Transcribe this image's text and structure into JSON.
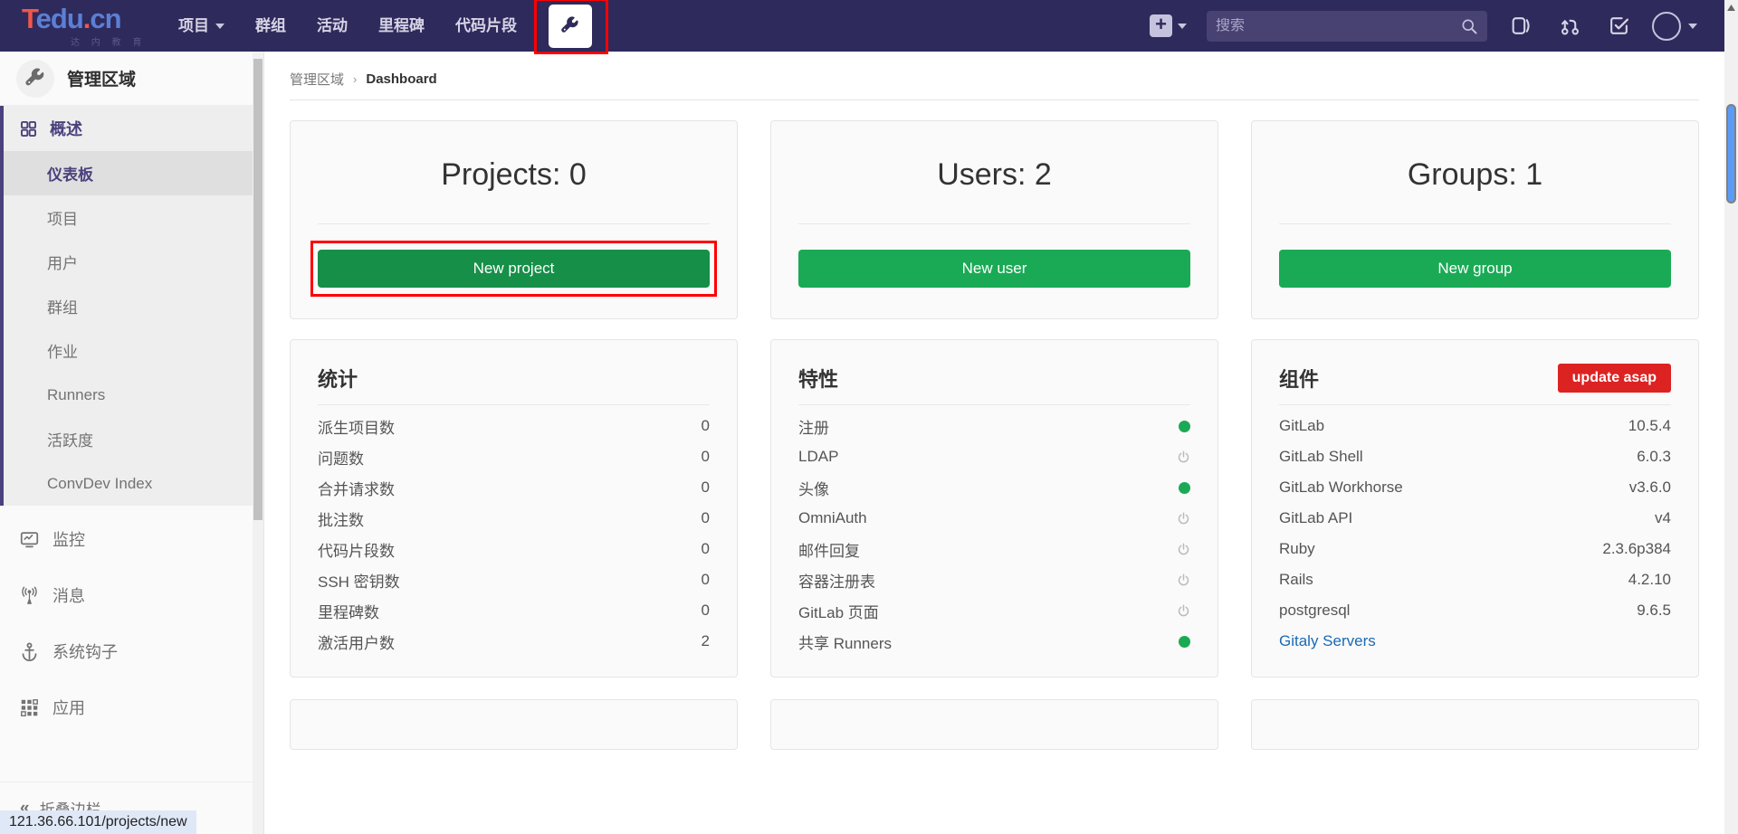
{
  "navbar": {
    "brand": {
      "t": "T",
      "edu": "edu",
      "dot": ".",
      "cn": "cn",
      "sub": "达 内 教 育"
    },
    "items": [
      {
        "label": "项目",
        "has_caret": true
      },
      {
        "label": "群组",
        "has_caret": false
      },
      {
        "label": "活动",
        "has_caret": false
      },
      {
        "label": "里程碑",
        "has_caret": false
      },
      {
        "label": "代码片段",
        "has_caret": false
      }
    ],
    "admin_icon": "wrench-icon",
    "plus_label": "+",
    "search": {
      "placeholder": "搜索",
      "value": ""
    },
    "right_icons": [
      "issues-icon",
      "merge-requests-icon",
      "todos-icon"
    ],
    "avatar": "user-avatar"
  },
  "sidebar": {
    "header": {
      "title": "管理区域",
      "icon": "wrench-icon"
    },
    "overview": {
      "label": "概述",
      "icon": "grid-icon"
    },
    "sub_items": [
      {
        "label": "仪表板",
        "active": true
      },
      {
        "label": "项目",
        "active": false
      },
      {
        "label": "用户",
        "active": false
      },
      {
        "label": "群组",
        "active": false
      },
      {
        "label": "作业",
        "active": false
      },
      {
        "label": "Runners",
        "active": false
      },
      {
        "label": "活跃度",
        "active": false
      },
      {
        "label": "ConvDev Index",
        "active": false
      }
    ],
    "bottom_items": [
      {
        "label": "监控",
        "icon": "monitor-icon"
      },
      {
        "label": "消息",
        "icon": "broadcast-icon"
      },
      {
        "label": "系统钩子",
        "icon": "anchor-icon"
      },
      {
        "label": "应用",
        "icon": "apps-grid-icon"
      }
    ],
    "collapse": {
      "label": "折叠边栏",
      "icon": "chevron-double-left-icon"
    }
  },
  "breadcrumb": {
    "root": "管理区域",
    "sep": "›",
    "current": "Dashboard"
  },
  "counters": [
    {
      "title": "Projects: 0",
      "button": "New project",
      "highlighted": true
    },
    {
      "title": "Users: 2",
      "button": "New user",
      "highlighted": false
    },
    {
      "title": "Groups: 1",
      "button": "New group",
      "highlighted": false
    }
  ],
  "statistics": {
    "title": "统计",
    "rows": [
      {
        "label": "派生项目数",
        "value": "0"
      },
      {
        "label": "问题数",
        "value": "0"
      },
      {
        "label": "合并请求数",
        "value": "0"
      },
      {
        "label": "批注数",
        "value": "0"
      },
      {
        "label": "代码片段数",
        "value": "0"
      },
      {
        "label": "SSH 密钥数",
        "value": "0"
      },
      {
        "label": "里程碑数",
        "value": "0"
      },
      {
        "label": "激活用户数",
        "value": "2"
      }
    ]
  },
  "features": {
    "title": "特性",
    "rows": [
      {
        "label": "注册",
        "state": "on"
      },
      {
        "label": "LDAP",
        "state": "off"
      },
      {
        "label": "头像",
        "state": "on"
      },
      {
        "label": "OmniAuth",
        "state": "off"
      },
      {
        "label": "邮件回复",
        "state": "off"
      },
      {
        "label": "容器注册表",
        "state": "off"
      },
      {
        "label": "GitLab 页面",
        "state": "off"
      },
      {
        "label": "共享 Runners",
        "state": "on"
      }
    ]
  },
  "components": {
    "title": "组件",
    "badge": "update asap",
    "rows": [
      {
        "label": "GitLab",
        "value": "10.5.4"
      },
      {
        "label": "GitLab Shell",
        "value": "6.0.3"
      },
      {
        "label": "GitLab Workhorse",
        "value": "v3.6.0"
      },
      {
        "label": "GitLab API",
        "value": "v4"
      },
      {
        "label": "Ruby",
        "value": "2.3.6p384"
      },
      {
        "label": "Rails",
        "value": "4.2.10"
      },
      {
        "label": "postgresql",
        "value": "9.6.5"
      }
    ],
    "link": "Gitaly Servers"
  },
  "statusbar": {
    "url": "121.36.66.101/projects/new"
  },
  "colors": {
    "navbar_bg": "#2e2a5b",
    "accent_green": "#1aaa55",
    "badge_red": "#dd2222",
    "highlight_red": "#ff0000",
    "sidebar_accent": "#4b417d",
    "link_blue": "#1b69b6"
  }
}
